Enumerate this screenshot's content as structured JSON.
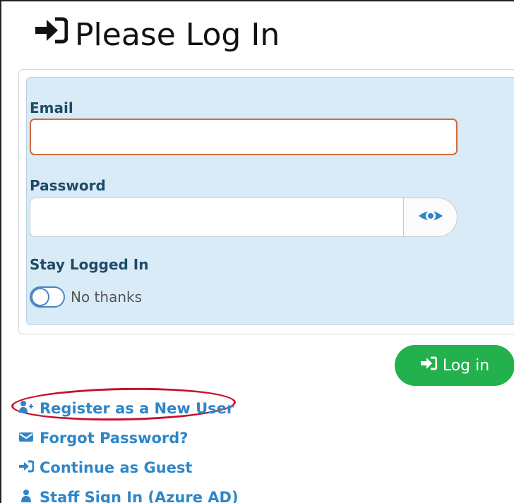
{
  "page": {
    "title": "Please Log In"
  },
  "form": {
    "email_label": "Email",
    "email_value": "",
    "password_label": "Password",
    "password_value": "",
    "stay_logged_in_label": "Stay Logged In",
    "toggle_text": "No thanks"
  },
  "actions": {
    "login_label": "Log in"
  },
  "links": [
    {
      "label": "Register as a New User",
      "icon": "user-plus-icon"
    },
    {
      "label": "Forgot Password?",
      "icon": "envelope-icon"
    },
    {
      "label": "Continue as Guest",
      "icon": "sign-in-icon"
    },
    {
      "label": "Staff Sign In (Azure AD)",
      "icon": "user-icon"
    }
  ],
  "colors": {
    "link": "#2f86c7",
    "login_button": "#22b14c",
    "panel": "#d9ebf7",
    "highlight": "#c8102e",
    "email_border": "#d16a3e"
  },
  "icons": {
    "title": "sign-in-icon",
    "password_toggle": "eye-icon"
  }
}
